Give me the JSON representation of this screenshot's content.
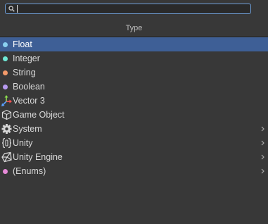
{
  "search": {
    "value": "",
    "placeholder": ""
  },
  "header": {
    "title": "Type"
  },
  "items": [
    {
      "label": "Float",
      "icon": "dot-icon",
      "color": "#8ad0f0",
      "selected": true,
      "submenu": false
    },
    {
      "label": "Integer",
      "icon": "dot-icon",
      "color": "#6fe8d6",
      "selected": false,
      "submenu": false
    },
    {
      "label": "String",
      "icon": "dot-icon",
      "color": "#f39a6a",
      "selected": false,
      "submenu": false
    },
    {
      "label": "Boolean",
      "icon": "dot-icon",
      "color": "#b79af0",
      "selected": false,
      "submenu": false
    },
    {
      "label": "Vector 3",
      "icon": "transform-axes-icon",
      "selected": false,
      "submenu": false
    },
    {
      "label": "Game Object",
      "icon": "cube-icon",
      "selected": false,
      "submenu": false
    },
    {
      "label": "System",
      "icon": "gear-icon",
      "selected": false,
      "submenu": true
    },
    {
      "label": "Unity",
      "icon": "braces-icon",
      "selected": false,
      "submenu": true
    },
    {
      "label": "Unity Engine",
      "icon": "unity-logo-icon",
      "selected": false,
      "submenu": true
    },
    {
      "label": "(Enums)",
      "icon": "dot-icon",
      "color": "#e68ad8",
      "selected": false,
      "submenu": true
    }
  ],
  "colors": {
    "background": "#383838",
    "selection": "#3e5f96",
    "search_border": "#6f9fd8"
  }
}
